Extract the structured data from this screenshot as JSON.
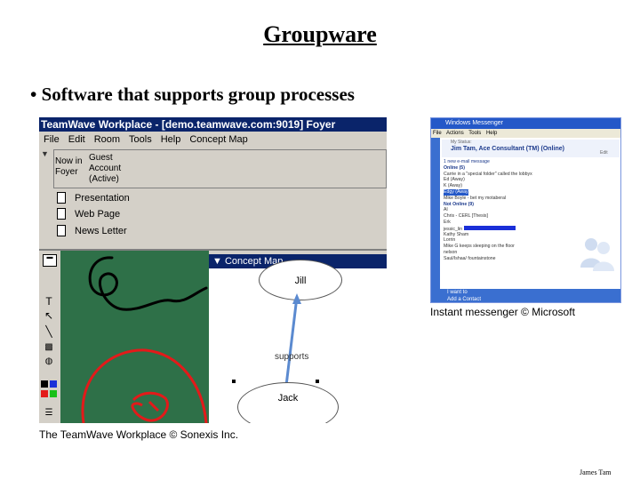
{
  "slide": {
    "title": "Groupware",
    "bullet": "• Software that supports group processes",
    "teamwave_caption": "The TeamWave Workplace © Sonexis Inc.",
    "messenger_caption": "Instant messenger © Microsoft",
    "author": "James Tam"
  },
  "teamwave": {
    "title": "TeamWave Workplace - [demo.teamwave.com:9019] Foyer",
    "menu": [
      "File",
      "Edit",
      "Room",
      "Tools",
      "Help",
      "Concept Map"
    ],
    "room_label": "Now in Foyer",
    "user_label": "Guest Account (Active)",
    "docs": [
      "Presentation",
      "Web Page",
      "News Letter"
    ],
    "concept_map": {
      "title": "Concept Map",
      "node_top": "Jill",
      "node_bottom": "Jack",
      "relation": "supports"
    },
    "tool_icons": [
      "text-tool-icon",
      "arrow-tool-icon",
      "line-tool-icon",
      "fill-tool-icon",
      "eraser-tool-icon"
    ],
    "palette": [
      "#000000",
      "#1a2fd8",
      "#e31a1a",
      "#18c018"
    ]
  },
  "messenger": {
    "title": "Windows Messenger",
    "menu": [
      "File",
      "Actions",
      "Tools",
      "Help"
    ],
    "status_label": "My Status:",
    "user": "Jim Tam, Ace Consultant (TM) (Online)",
    "mail": "1 new e-mail message",
    "online_header": "Online (5)",
    "online": [
      "Carrie in a \"special folder\" called the lobbyx",
      "Ed (Away)",
      "K (Away)",
      "Edgy (Away)",
      "Mike Boyle - bet my motaberal"
    ],
    "offline_header": "Not Online (9)",
    "offline": [
      "Al",
      "Chris - CERL [Thesis]",
      "Erk",
      "jessic_lin",
      "Kathy Sham",
      "Lorrin",
      "Mike G keeps sleeping on the floor",
      "nelson",
      "Saul/Ishaa/ fountainstone"
    ],
    "footer": [
      "I want to",
      "Add a Contact"
    ]
  }
}
